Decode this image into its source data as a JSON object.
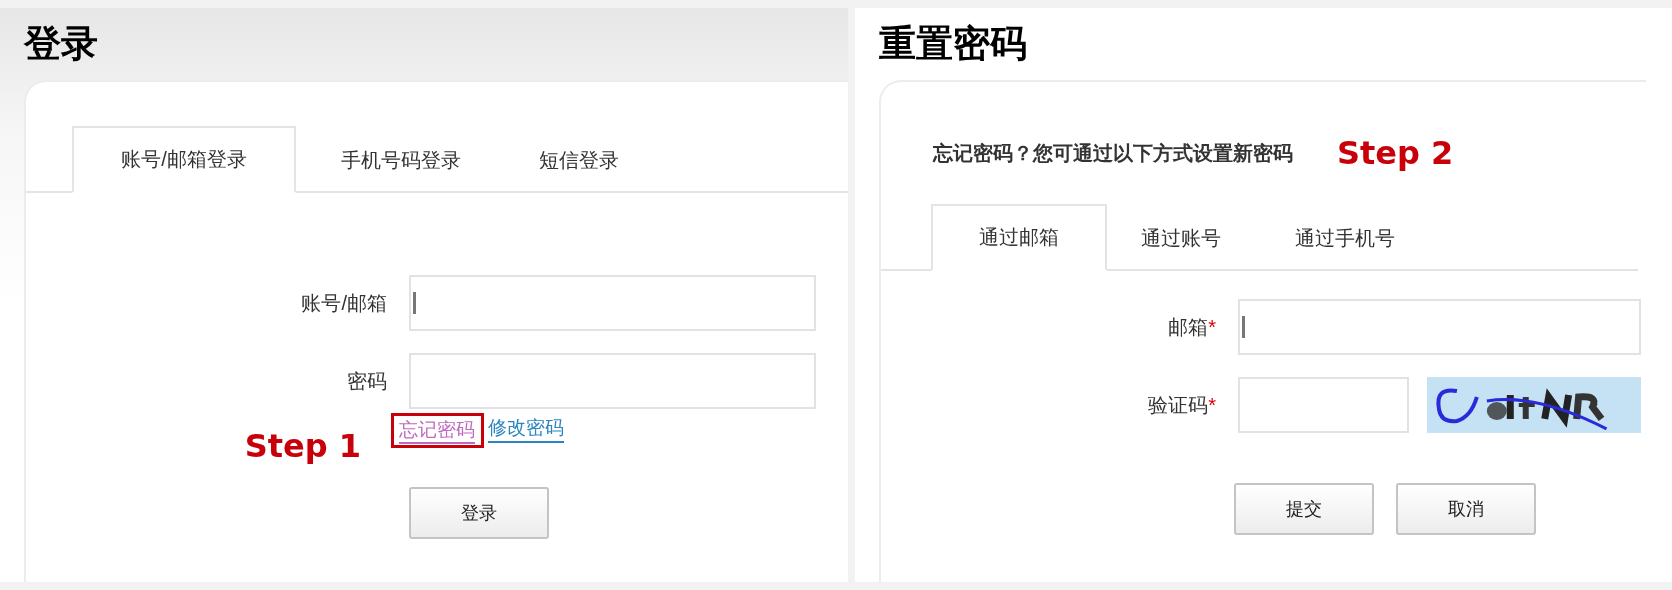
{
  "login": {
    "title": "登录",
    "tabs": [
      {
        "label": "账号/邮箱登录",
        "selected": true
      },
      {
        "label": "手机号码登录",
        "selected": false
      },
      {
        "label": "短信登录",
        "selected": false
      }
    ],
    "fields": [
      {
        "label": "账号/邮箱",
        "focused": true
      },
      {
        "label": "密码",
        "focused": false
      }
    ],
    "links": [
      {
        "text": "忘记密码",
        "visited": true,
        "highlighted": true
      },
      {
        "text": "修改密码",
        "visited": false,
        "highlighted": false
      }
    ],
    "step": "Step 1",
    "buttons": [
      "登录"
    ]
  },
  "reset": {
    "title": "重置密码",
    "intro": "忘记密码？您可通过以下方式设置新密码",
    "step": "Step 2",
    "tabs": [
      {
        "label": "通过邮箱",
        "selected": true
      },
      {
        "label": "通过账号",
        "selected": false
      },
      {
        "label": "通过手机号",
        "selected": false
      }
    ],
    "fields": [
      {
        "kind": "text",
        "label": "邮箱",
        "mark": "*",
        "focused": true
      },
      {
        "kind": "captcha",
        "label": "验证码",
        "mark": "*",
        "focused": false
      }
    ],
    "buttons": [
      "提交",
      "取消"
    ]
  }
}
